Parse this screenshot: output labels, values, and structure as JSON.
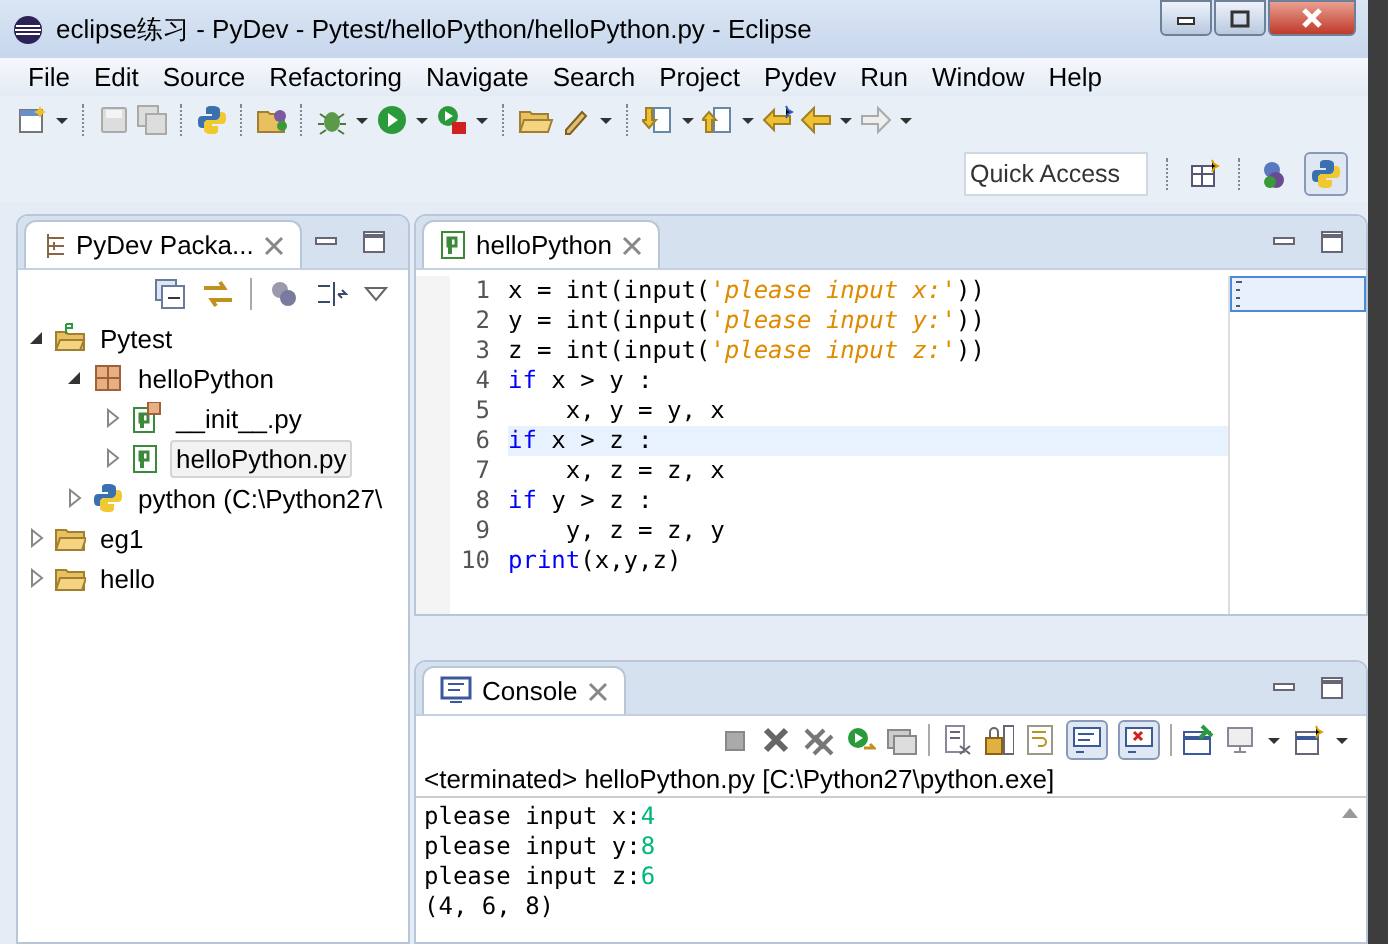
{
  "window": {
    "title": "eclipse练习 - PyDev - Pytest/helloPython/helloPython.py - Eclipse"
  },
  "menu": [
    "File",
    "Edit",
    "Source",
    "Refactoring",
    "Navigate",
    "Search",
    "Project",
    "Pydev",
    "Run",
    "Window",
    "Help"
  ],
  "quick_access": {
    "placeholder": "Quick Access"
  },
  "explorer": {
    "tab": "PyDev Packa...",
    "tree": [
      {
        "label": "Pytest",
        "kind": "project",
        "expanded": true,
        "selected": false,
        "children": [
          {
            "label": "helloPython",
            "kind": "package",
            "expanded": true,
            "selected": false,
            "children": [
              {
                "label": "__init__.py",
                "kind": "initfile",
                "expanded": false,
                "selected": false
              },
              {
                "label": "helloPython.py",
                "kind": "pyfile",
                "expanded": false,
                "selected": true
              }
            ]
          },
          {
            "label": "python  (C:\\Python27\\",
            "kind": "interpreter",
            "expanded": false,
            "selected": false
          }
        ]
      },
      {
        "label": "eg1",
        "kind": "folder",
        "expanded": false,
        "selected": false
      },
      {
        "label": "hello",
        "kind": "folder",
        "expanded": false,
        "selected": false
      }
    ]
  },
  "editor": {
    "tab": "helloPython",
    "lines": [
      {
        "number": "1",
        "current": false,
        "tokens": [
          {
            "kind": "plain",
            "text": "x = int(input("
          },
          {
            "kind": "string",
            "text": "'please input x:'"
          },
          {
            "kind": "plain",
            "text": "))"
          }
        ]
      },
      {
        "number": "2",
        "current": false,
        "tokens": [
          {
            "kind": "plain",
            "text": "y = int(input("
          },
          {
            "kind": "string",
            "text": "'please input y:'"
          },
          {
            "kind": "plain",
            "text": "))"
          }
        ]
      },
      {
        "number": "3",
        "current": false,
        "tokens": [
          {
            "kind": "plain",
            "text": "z = int(input("
          },
          {
            "kind": "string",
            "text": "'please input z:'"
          },
          {
            "kind": "plain",
            "text": "))"
          }
        ]
      },
      {
        "number": "4",
        "current": false,
        "tokens": [
          {
            "kind": "keyword",
            "text": "if"
          },
          {
            "kind": "plain",
            "text": " x > y :"
          }
        ]
      },
      {
        "number": "5",
        "current": false,
        "tokens": [
          {
            "kind": "plain",
            "text": "    x, y = y, x"
          }
        ]
      },
      {
        "number": "6",
        "current": true,
        "tokens": [
          {
            "kind": "keyword",
            "text": "if"
          },
          {
            "kind": "plain",
            "text": " x > z :"
          }
        ]
      },
      {
        "number": "7",
        "current": false,
        "tokens": [
          {
            "kind": "plain",
            "text": "    x, z = z, x"
          }
        ]
      },
      {
        "number": "8",
        "current": false,
        "tokens": [
          {
            "kind": "keyword",
            "text": "if"
          },
          {
            "kind": "plain",
            "text": " y > z :"
          }
        ]
      },
      {
        "number": "9",
        "current": false,
        "tokens": [
          {
            "kind": "plain",
            "text": "    y, z = z, y"
          }
        ]
      },
      {
        "number": "10",
        "current": false,
        "tokens": [
          {
            "kind": "keyword",
            "text": "print"
          },
          {
            "kind": "plain",
            "text": "(x,y,z)"
          }
        ]
      }
    ]
  },
  "console": {
    "tab": "Console",
    "status": "<terminated> helloPython.py [C:\\Python27\\python.exe]",
    "output": [
      {
        "prompt": "please input x:",
        "input": "4"
      },
      {
        "prompt": "please input y:",
        "input": "8"
      },
      {
        "prompt": "please input z:",
        "input": "6"
      },
      {
        "prompt": "(4, 6, 8)"
      }
    ]
  }
}
